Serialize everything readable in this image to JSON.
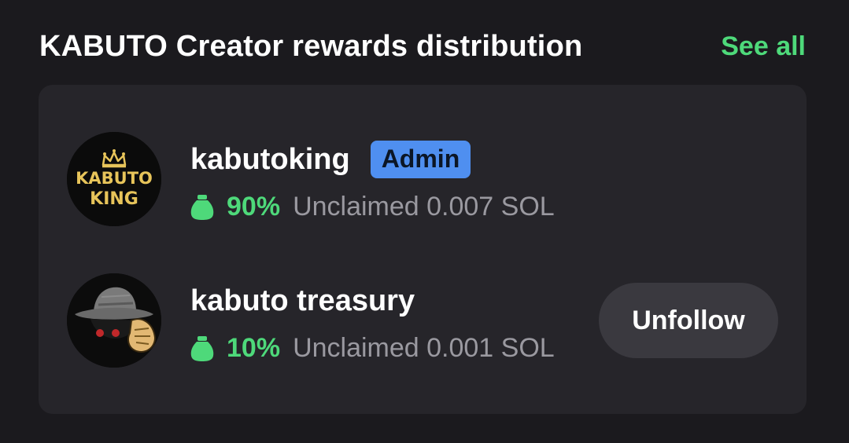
{
  "header": {
    "title": "KABUTO Creator rewards distribution",
    "see_all_label": "See all"
  },
  "recipients": [
    {
      "name": "kabutoking",
      "badge": "Admin",
      "percent": "90%",
      "unclaimed": "Unclaimed 0.007 SOL",
      "avatar_text_line1": "KABUTO",
      "avatar_text_line2": "KING"
    },
    {
      "name": "kabuto treasury",
      "percent": "10%",
      "unclaimed": "Unclaimed 0.001 SOL",
      "action_label": "Unfollow"
    }
  ],
  "colors": {
    "background": "#1b1a1e",
    "card": "#26252a",
    "accent_green": "#4ed97a",
    "admin_badge": "#4f8ff0",
    "muted_text": "#9a99a0",
    "button": "#3a393f"
  },
  "icons": {
    "percent_icon": "money-bag-icon"
  }
}
